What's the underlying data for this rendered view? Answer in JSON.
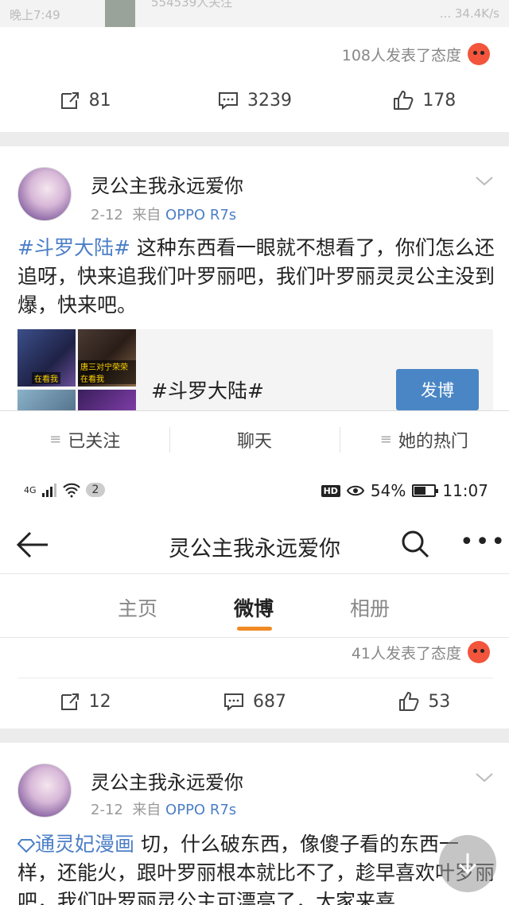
{
  "top_faded": {
    "left_text": "晚上7:49",
    "right_text": "... 34.4K/s",
    "caption": "554539人关注"
  },
  "post_1": {
    "reaction_text": "108人发表了态度",
    "repost_count": "81",
    "comment_count": "3239",
    "like_count": "178"
  },
  "post_2": {
    "username": "灵公主我永远爱你",
    "date": "2-12",
    "source_prefix": "来自",
    "device": "OPPO R7s",
    "tag": "#斗罗大陆#",
    "text": " 这种东西看一眼就不想看了，你们怎么还追呀，快来追我们叶罗丽吧，我们叶罗丽灵灵公主没到爆，快来吧。",
    "topic": {
      "title": "#斗罗大陆#",
      "button_label": "发博",
      "thumb_captions": [
        "在看我",
        "唐三对宁荣荣在看我"
      ]
    }
  },
  "profile_tabs": [
    {
      "label": "已关注"
    },
    {
      "label": "聊天"
    },
    {
      "label": "她的热门"
    }
  ],
  "status_bar": {
    "signal": "4G",
    "notif_count": "2",
    "battery": "54%",
    "time": "11:07"
  },
  "nav": {
    "title": "灵公主我永远爱你"
  },
  "content_tabs": [
    {
      "label": "主页",
      "active": false
    },
    {
      "label": "微博",
      "active": true
    },
    {
      "label": "相册",
      "active": false
    }
  ],
  "post_3": {
    "reaction_text": "41人发表了态度",
    "repost_count": "12",
    "comment_count": "687",
    "like_count": "53"
  },
  "post_4": {
    "username": "灵公主我永远爱你",
    "date": "2-12",
    "source_prefix": "来自",
    "device": "OPPO R7s",
    "tag": "通灵妃漫画",
    "text": " 切，什么破东西，像傻子看的东西一样，还能火，跟叶罗丽根本就比不了，趁早喜欢叶罗丽吧，我们叶罗丽灵公主可漂亮了，大家来喜"
  },
  "colors": {
    "link_blue": "#4c7fc7",
    "accent_orange": "#f08a24",
    "button_blue": "#4a86c5"
  }
}
